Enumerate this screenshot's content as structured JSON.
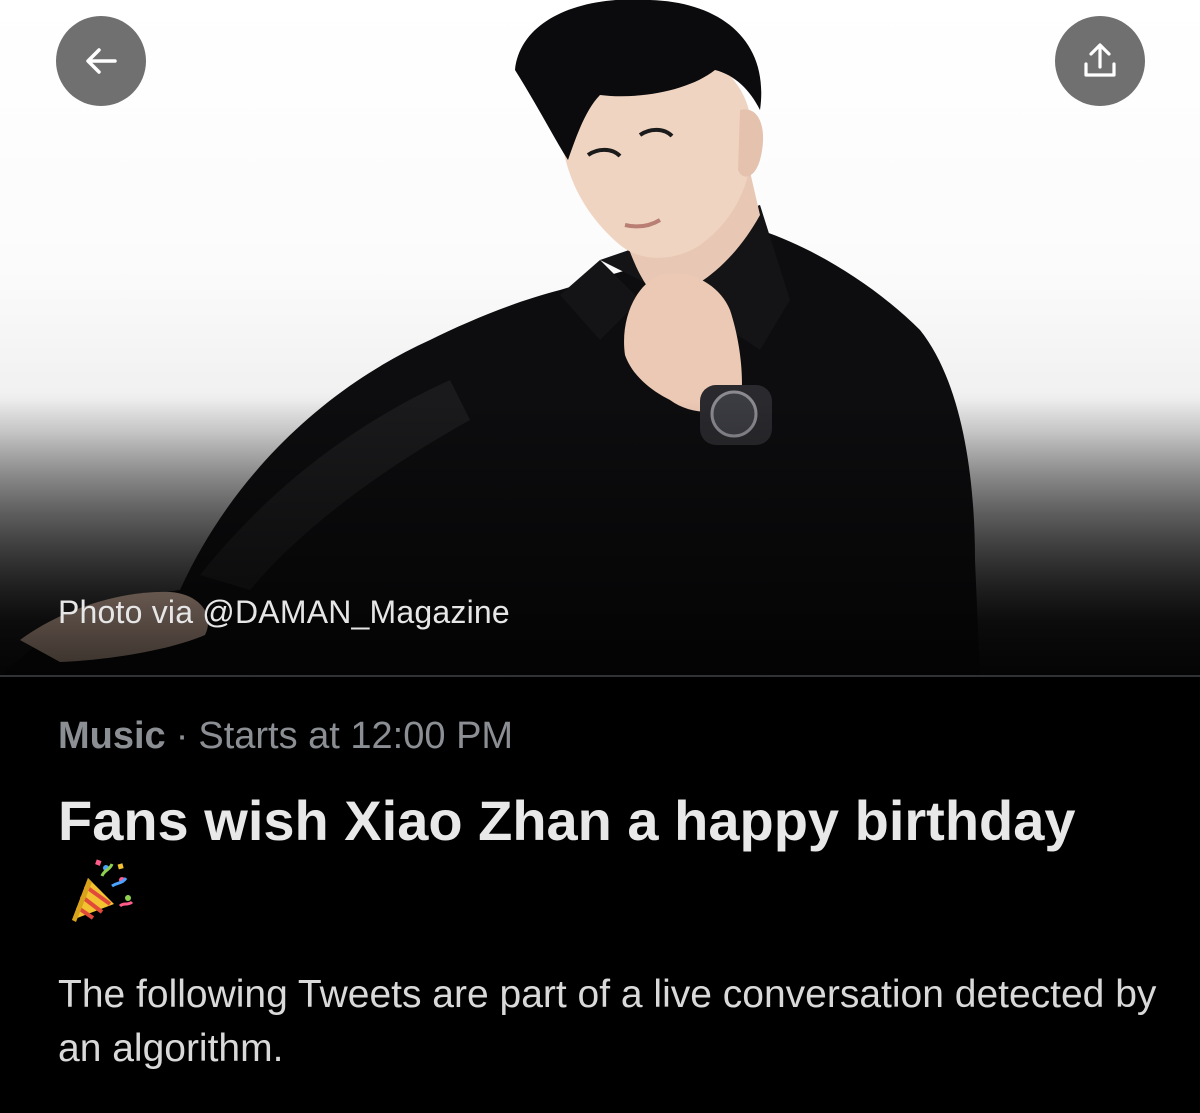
{
  "header": {
    "back_icon": "arrow-left-icon",
    "share_icon": "share-upload-icon",
    "photo_credit": "Photo via @DAMAN_Magazine",
    "button_color": "#646464"
  },
  "event": {
    "category": "Music",
    "separator": "·",
    "start_time": "Starts at 12:00 PM",
    "title": "Fans wish Xiao Zhan a happy birthday",
    "title_emoji": "party-popper-icon",
    "description": "The following Tweets are part of a live conversation detected by an algorithm."
  },
  "colors": {
    "background": "#000000",
    "title_text": "#e8e8e8",
    "meta_text": "#8b8f94",
    "body_text": "#d9d9d9"
  }
}
